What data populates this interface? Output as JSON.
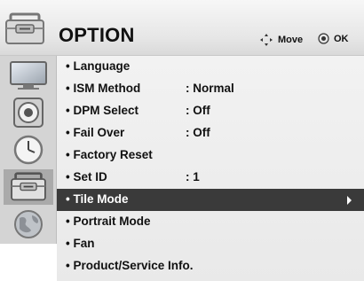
{
  "header": {
    "title": "OPTION",
    "icon": "option-toolbox-icon",
    "hints": [
      {
        "label": "Move",
        "icon": "move-arrows-icon"
      },
      {
        "label": "OK",
        "icon": "ok-circle-icon"
      }
    ]
  },
  "sidebar": {
    "items": [
      {
        "icon": "picture-icon",
        "active": false
      },
      {
        "icon": "audio-icon",
        "active": false
      },
      {
        "icon": "time-icon",
        "active": false
      },
      {
        "icon": "option-toolbox-icon",
        "active": true
      },
      {
        "icon": "network-globe-icon",
        "active": false
      }
    ]
  },
  "menu": {
    "items": [
      {
        "label": "• Language",
        "value": "",
        "selected": false
      },
      {
        "label": "• ISM Method",
        "value": ": Normal",
        "selected": false
      },
      {
        "label": "• DPM Select",
        "value": ": Off",
        "selected": false
      },
      {
        "label": "• Fail Over",
        "value": ": Off",
        "selected": false
      },
      {
        "label": "• Factory Reset",
        "value": "",
        "selected": false
      },
      {
        "label": "• Set ID",
        "value": ": 1",
        "selected": false
      },
      {
        "label": "• Tile Mode",
        "value": "",
        "selected": true
      },
      {
        "label": "• Portrait Mode",
        "value": "",
        "selected": false
      },
      {
        "label": "• Fan",
        "value": "",
        "selected": false
      },
      {
        "label": "• Product/Service Info.",
        "value": "",
        "selected": false
      }
    ]
  },
  "colors": {
    "selected_bg": "#3a3a3a",
    "sidebar_bg": "#d4d4d4",
    "sidebar_active": "#aaaaaa"
  }
}
